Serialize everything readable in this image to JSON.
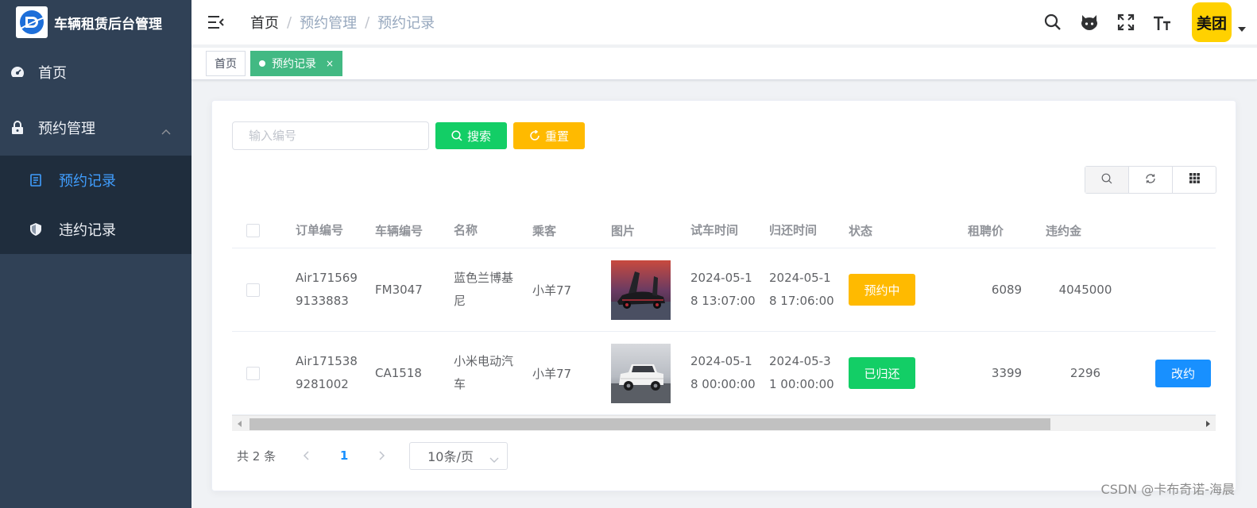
{
  "app": {
    "title": "车辆租赁后台管理"
  },
  "sidebar": {
    "items": [
      {
        "label": "首页",
        "icon": "dashboard-icon"
      },
      {
        "label": "预约管理",
        "icon": "lock-icon",
        "expanded": true,
        "children": [
          {
            "label": "预约记录",
            "icon": "document-icon",
            "active": true
          },
          {
            "label": "违约记录",
            "icon": "shield-icon",
            "active": false
          }
        ]
      }
    ]
  },
  "header": {
    "breadcrumb": [
      "首页",
      "预约管理",
      "预约记录"
    ],
    "avatar_text": "美团",
    "icons": [
      "search-icon",
      "github-icon",
      "fullscreen-icon",
      "text-size-icon"
    ]
  },
  "tags": [
    {
      "label": "首页",
      "active": false
    },
    {
      "label": "预约记录",
      "active": true,
      "close": "×"
    }
  ],
  "search": {
    "placeholder": "输入编号",
    "value": "",
    "search_label": "搜索",
    "reset_label": "重置"
  },
  "table": {
    "columns": [
      "订单编号",
      "车辆编号",
      "名称",
      "乘客",
      "图片",
      "试车时间",
      "归还时间",
      "状态",
      "租聘价",
      "违约金"
    ],
    "rows": [
      {
        "order_l1": "Air171569",
        "order_l2": "9133883",
        "car": "FM3047",
        "name_l1": "蓝色兰博基",
        "name_l2": "尼",
        "passenger": "小羊77",
        "rent_l1": "2024-05-1",
        "rent_l2": "8 13:07:00",
        "ret_l1": "2024-05-1",
        "ret_l2": "8 17:06:00",
        "status": "预约中",
        "price": "6089",
        "penalty": "4045000",
        "action": ""
      },
      {
        "order_l1": "Air171538",
        "order_l2": "9281002",
        "car": "CA1518",
        "name_l1": "小米电动汽",
        "name_l2": "车",
        "passenger": "小羊77",
        "rent_l1": "2024-05-1",
        "rent_l2": "8 00:00:00",
        "ret_l1": "2024-05-3",
        "ret_l2": "1 00:00:00",
        "status": "已归还",
        "price": "3399",
        "penalty": "2296",
        "action": "改约"
      }
    ]
  },
  "pagination": {
    "total": "共 2 条",
    "current": "1",
    "page_size": "10条/页"
  },
  "watermark": "CSDN @卡布奇诺-海晨",
  "colors": {
    "sidebar_bg": "#304156",
    "submenu_bg": "#1f2d3d",
    "active_menu": "#409eff",
    "tag_active": "#42b983",
    "success": "#13ce66",
    "warning": "#ffba00",
    "primary": "#1890ff"
  }
}
